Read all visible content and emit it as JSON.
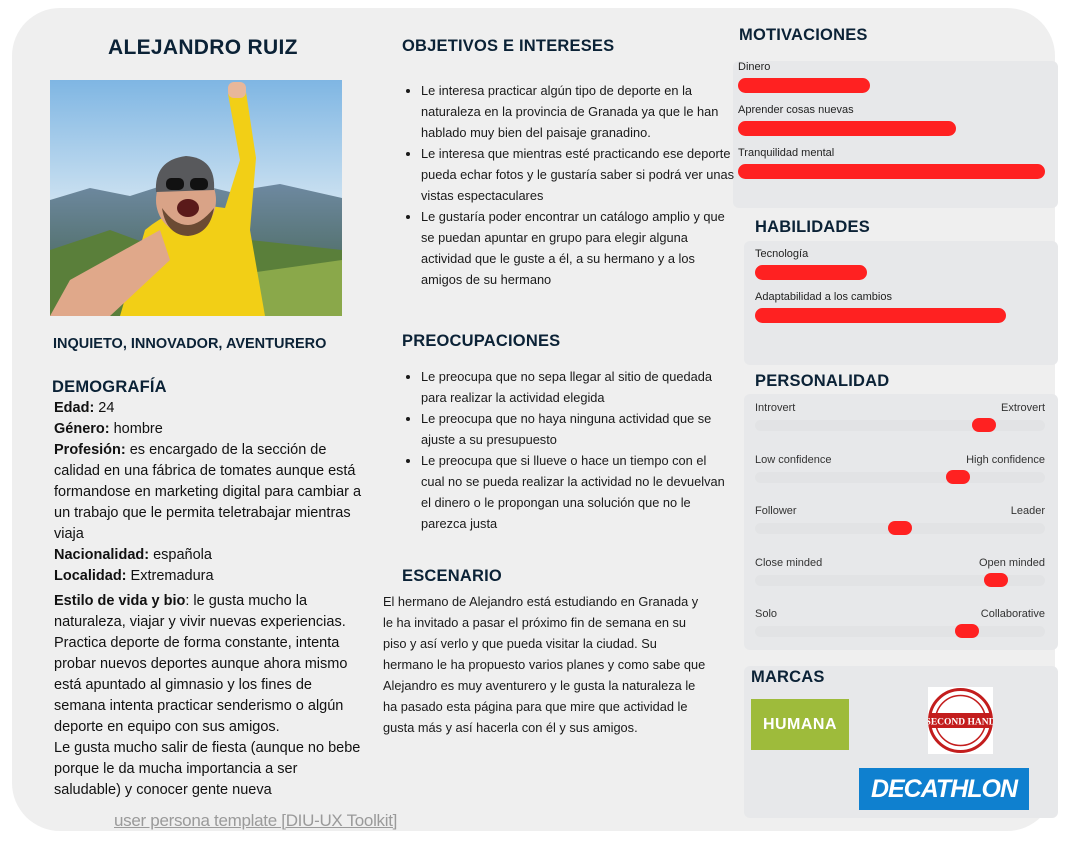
{
  "persona": {
    "name": "ALEJANDRO RUIZ",
    "traits": "INQUIETO, INNOVADOR, AVENTURERO"
  },
  "demographics": {
    "title": "DEMOGRAFÍA",
    "age_label": "Edad:",
    "age": " 24",
    "gender_label": "Género:",
    "gender": " hombre",
    "profession_label": "Profesión:",
    "profession": " es encargado de la sección de calidad en una fábrica de tomates aunque está formandose en marketing digital para cambiar a un trabajo que le permita teletrabajar mientras viaja",
    "nationality_label": "Nacionalidad:",
    "nationality": " española",
    "location_label": "Localidad:",
    "location": " Extremadura",
    "lifestyle_label": "Estilo de vida y bio",
    "lifestyle": ": le gusta mucho la naturaleza, viajar y vivir nuevas experiencias. Practica deporte de forma constante, intenta probar nuevos deportes aunque ahora mismo está apuntado al gimnasio y los fines de semana intenta practicar senderismo o algún deporte en equipo con sus amigos.",
    "lifestyle2": "Le gusta mucho salir de fiesta (aunque no bebe porque le da mucha importancia a ser saludable) y conocer gente nueva"
  },
  "goals": {
    "title": "OBJETIVOS E INTERESES",
    "items": [
      "Le interesa practicar algún tipo de deporte en la naturaleza en la provincia de Granada ya que le han hablado muy bien del paisaje granadino.",
      "Le interesa que mientras esté practicando ese deporte pueda echar fotos y le gustaría saber si podrá ver unas vistas espectaculares",
      "Le gustaría poder encontrar un catálogo amplio y que se puedan apuntar en grupo para elegir alguna actividad que le guste a él, a su hermano y a los amigos de su hermano"
    ]
  },
  "concerns": {
    "title": "PREOCUPACIONES",
    "items": [
      "Le preocupa que no sepa llegar al sitio de quedada para realizar la actividad elegida",
      "Le preocupa que no haya ninguna actividad que se ajuste a su presupuesto",
      "Le preocupa que si llueve o hace un tiempo con el cual no se pueda realizar la actividad no le devuelvan el dinero o le propongan una solución que no le parezca justa"
    ]
  },
  "scenario": {
    "title": "ESCENARIO",
    "text": "El hermano de Alejandro está estudiando en Granada y le ha invitado a pasar el próximo fin de semana en su piso y así verlo y que pueda visitar la ciudad. Su hermano le ha propuesto varios planes y como sabe que Alejandro es muy aventurero y le gusta la naturaleza le ha pasado esta página para que mire que actividad le gusta más y así hacerla con él y sus amigos."
  },
  "motivations": {
    "title": "MOTIVACIONES",
    "items": [
      {
        "label": "Dinero",
        "value": 0.43
      },
      {
        "label": "Aprender cosas nuevas",
        "value": 0.71
      },
      {
        "label": "Tranquilidad mental",
        "value": 1.0
      }
    ]
  },
  "skills": {
    "title": "HABILIDADES",
    "items": [
      {
        "label": "Tecnología",
        "value": 0.39
      },
      {
        "label": "Adaptabilidad a los cambios",
        "value": 0.87
      }
    ]
  },
  "personality": {
    "title": "PERSONALIDAD",
    "items": [
      {
        "left": "Introvert",
        "right": "Extrovert",
        "value": 0.79
      },
      {
        "left": "Low confidence",
        "right": "High confidence",
        "value": 0.7
      },
      {
        "left": "Follower",
        "right": "Leader",
        "value": 0.5
      },
      {
        "left": "Close minded",
        "right": "Open minded",
        "value": 0.83
      },
      {
        "left": "Solo",
        "right": "Collaborative",
        "value": 0.73
      }
    ]
  },
  "brands": {
    "title": "MARCAS",
    "humana": "HUMANA",
    "decathlon": "DECATHLON",
    "secondhand": "SECOND HAND"
  },
  "footer": "user persona template [DIU-UX Toolkit]",
  "colors": {
    "accent": "#ff2121",
    "heading": "#0b2236",
    "panel": "#e7e8ea"
  }
}
